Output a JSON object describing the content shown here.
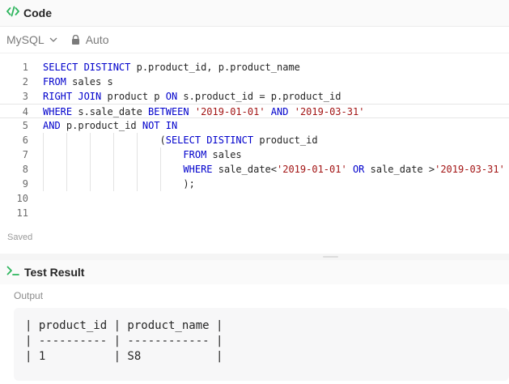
{
  "code_panel": {
    "title": "Code",
    "icon": "code-icon",
    "accent_color": "#2db55d"
  },
  "toolbar": {
    "language": "MySQL",
    "mode": "Auto"
  },
  "editor": {
    "active_line": 4,
    "lines": [
      {
        "n": "1",
        "indent": "",
        "tokens": [
          {
            "t": "SELECT DISTINCT",
            "c": "kw"
          },
          {
            "t": " p.product_id, p.product_name",
            "c": ""
          }
        ]
      },
      {
        "n": "2",
        "indent": "",
        "tokens": [
          {
            "t": "FROM",
            "c": "kw"
          },
          {
            "t": " sales s",
            "c": ""
          }
        ]
      },
      {
        "n": "3",
        "indent": "",
        "tokens": [
          {
            "t": "RIGHT JOIN",
            "c": "kw"
          },
          {
            "t": " product p ",
            "c": ""
          },
          {
            "t": "ON",
            "c": "kw"
          },
          {
            "t": " s.product_id = p.product_id",
            "c": ""
          }
        ]
      },
      {
        "n": "4",
        "indent": "",
        "tokens": [
          {
            "t": "WHERE",
            "c": "kw"
          },
          {
            "t": " s.sale_date ",
            "c": ""
          },
          {
            "t": "BETWEEN",
            "c": "kw"
          },
          {
            "t": " ",
            "c": ""
          },
          {
            "t": "'2019-01-01'",
            "c": "str"
          },
          {
            "t": " ",
            "c": ""
          },
          {
            "t": "AND",
            "c": "kw"
          },
          {
            "t": " ",
            "c": ""
          },
          {
            "t": "'2019-03-31'",
            "c": "str"
          }
        ]
      },
      {
        "n": "5",
        "indent": "",
        "tokens": [
          {
            "t": "AND",
            "c": "kw"
          },
          {
            "t": " p.product_id ",
            "c": ""
          },
          {
            "t": "NOT IN",
            "c": "kw"
          }
        ]
      },
      {
        "n": "6",
        "indent": "                    ",
        "tokens": [
          {
            "t": "(",
            "c": ""
          },
          {
            "t": "SELECT DISTINCT",
            "c": "kw"
          },
          {
            "t": " product_id",
            "c": ""
          }
        ]
      },
      {
        "n": "7",
        "indent": "                        ",
        "tokens": [
          {
            "t": "FROM",
            "c": "kw"
          },
          {
            "t": " sales",
            "c": ""
          }
        ]
      },
      {
        "n": "8",
        "indent": "                        ",
        "tokens": [
          {
            "t": "WHERE",
            "c": "kw"
          },
          {
            "t": " sale_date<",
            "c": ""
          },
          {
            "t": "'2019-01-01'",
            "c": "str"
          },
          {
            "t": " ",
            "c": ""
          },
          {
            "t": "OR",
            "c": "kw"
          },
          {
            "t": " sale_date >",
            "c": ""
          },
          {
            "t": "'2019-03-31'",
            "c": "str"
          }
        ]
      },
      {
        "n": "9",
        "indent": "                        ",
        "tokens": [
          {
            "t": ");",
            "c": ""
          }
        ]
      },
      {
        "n": "10",
        "indent": "",
        "tokens": []
      },
      {
        "n": "11",
        "indent": "",
        "tokens": []
      }
    ]
  },
  "status": {
    "saved_text": "Saved"
  },
  "result_panel": {
    "title": "Test Result",
    "icon": "terminal-icon",
    "output_label": "Output",
    "output_text": "| product_id | product_name |\n| ---------- | ------------ |\n| 1          | S8           |"
  }
}
